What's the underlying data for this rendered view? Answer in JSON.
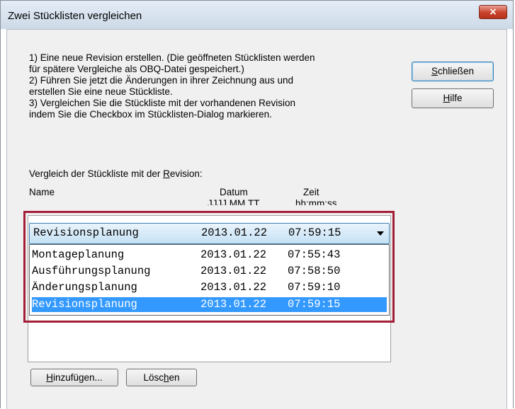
{
  "window": {
    "title": "Zwei Stücklisten vergleichen",
    "close_glyph": "×"
  },
  "instructions": [
    "1) Eine neue Revision erstellen. (Die geöffneten Stücklisten werden",
    "für spätere Vergleiche als OBQ-Datei gespeichert.)",
    "2) Führen Sie jetzt die Änderungen in ihrer Zeichnung aus und",
    "erstellen Sie eine neue Stückliste.",
    "3) Vergleichen Sie die Stückliste mit der vorhandenen Revision",
    "indem Sie die Checkbox im Stücklisten-Dialog markieren."
  ],
  "buttons": {
    "close": {
      "pre": "",
      "key": "S",
      "post": "chließen"
    },
    "help": {
      "pre": "",
      "key": "H",
      "post": "ilfe"
    },
    "add": {
      "pre": "",
      "key": "H",
      "post": "inzufügen..."
    },
    "delete": {
      "pre": "Lösc",
      "key": "h",
      "post": "en"
    }
  },
  "compare_label": {
    "pre": "Vergleich der Stückliste mit der ",
    "key": "R",
    "post": "evision:"
  },
  "columns": {
    "name": "Name",
    "date": "Datum",
    "date_format": "JJJJ.MM.TT",
    "time": "Zeit",
    "time_format": "hh:mm:ss"
  },
  "combo": {
    "name": "Revisionsplanung",
    "date": "2013.01.22",
    "time": "07:59:15"
  },
  "revisions": [
    {
      "name": "Montageplanung",
      "date": "2013.01.22",
      "time": "07:55:43",
      "selected": false
    },
    {
      "name": "Ausführungsplanung",
      "date": "2013.01.22",
      "time": "07:58:50",
      "selected": false
    },
    {
      "name": "Änderungsplanung",
      "date": "2013.01.22",
      "time": "07:59:10",
      "selected": false
    },
    {
      "name": "Revisionsplanung",
      "date": "2013.01.22",
      "time": "07:59:15",
      "selected": true
    }
  ],
  "colors": {
    "highlight_border": "#a41d37",
    "selection": "#3399ff",
    "close_button": "#c8412b"
  }
}
